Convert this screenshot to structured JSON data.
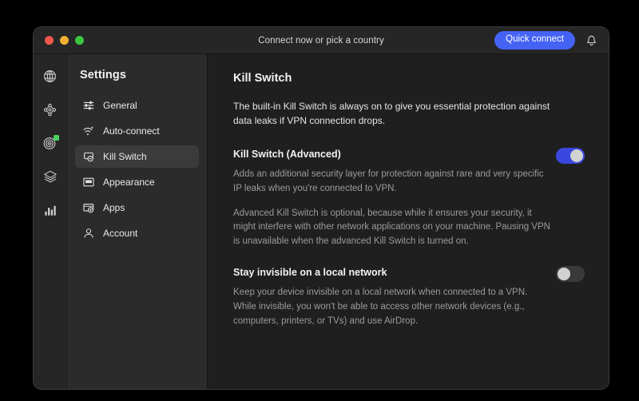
{
  "titlebar": {
    "center_text": "Connect now or pick a country",
    "quick_connect_label": "Quick connect",
    "bell_icon": "bell-icon",
    "traffic_lights": [
      "close-red",
      "minimize-yellow",
      "zoom-green"
    ]
  },
  "icon_rail": {
    "items": [
      {
        "name": "globe-icon",
        "label": "VPN locations"
      },
      {
        "name": "mesh-network-icon",
        "label": "Meshnet"
      },
      {
        "name": "threat-radar-icon",
        "label": "Threat Protection",
        "status_dot": "#4ad15e"
      },
      {
        "name": "layers-icon",
        "label": "Dark Web Monitor"
      },
      {
        "name": "bar-chart-icon",
        "label": "Statistics"
      }
    ]
  },
  "sidebar": {
    "title": "Settings",
    "items": [
      {
        "label": "General",
        "icon": "sliders-icon",
        "active": false
      },
      {
        "label": "Auto-connect",
        "icon": "wifi-sparkle-icon",
        "active": false
      },
      {
        "label": "Kill Switch",
        "icon": "kill-switch-icon",
        "active": true
      },
      {
        "label": "Appearance",
        "icon": "appearance-window-icon",
        "active": false
      },
      {
        "label": "Apps",
        "icon": "apps-plus-icon",
        "active": false
      },
      {
        "label": "Account",
        "icon": "account-person-icon",
        "active": false
      }
    ]
  },
  "content": {
    "title": "Kill Switch",
    "intro": "The built-in Kill Switch is always on to give you essential protection against data leaks if VPN connection drops.",
    "settings": [
      {
        "name": "Kill Switch (Advanced)",
        "desc1": "Adds an additional security layer for protection against rare and very specific IP leaks when you're connected to VPN.",
        "desc2": "Advanced Kill Switch is optional, because while it ensures your security, it might interfere with other network applications on your machine. Pausing VPN is unavailable when the advanced Kill Switch is turned on.",
        "toggle_state": "on"
      },
      {
        "name": "Stay invisible on a local network",
        "desc1": "Keep your device invisible on a local network when connected to a VPN. While invisible, you won't be able to access other network devices (e.g., computers, printers, or TVs) and use AirDrop.",
        "desc2": "",
        "toggle_state": "off"
      }
    ]
  },
  "colors": {
    "accent_blue": "#4463f5",
    "toggle_on": "#3b48e0",
    "toggle_off": "#3a3a3a",
    "status_green": "#4ad15e",
    "window_bg": "#1f1f1f",
    "sidebar_bg": "#2b2b2b",
    "titlebar_bg": "#262626"
  }
}
